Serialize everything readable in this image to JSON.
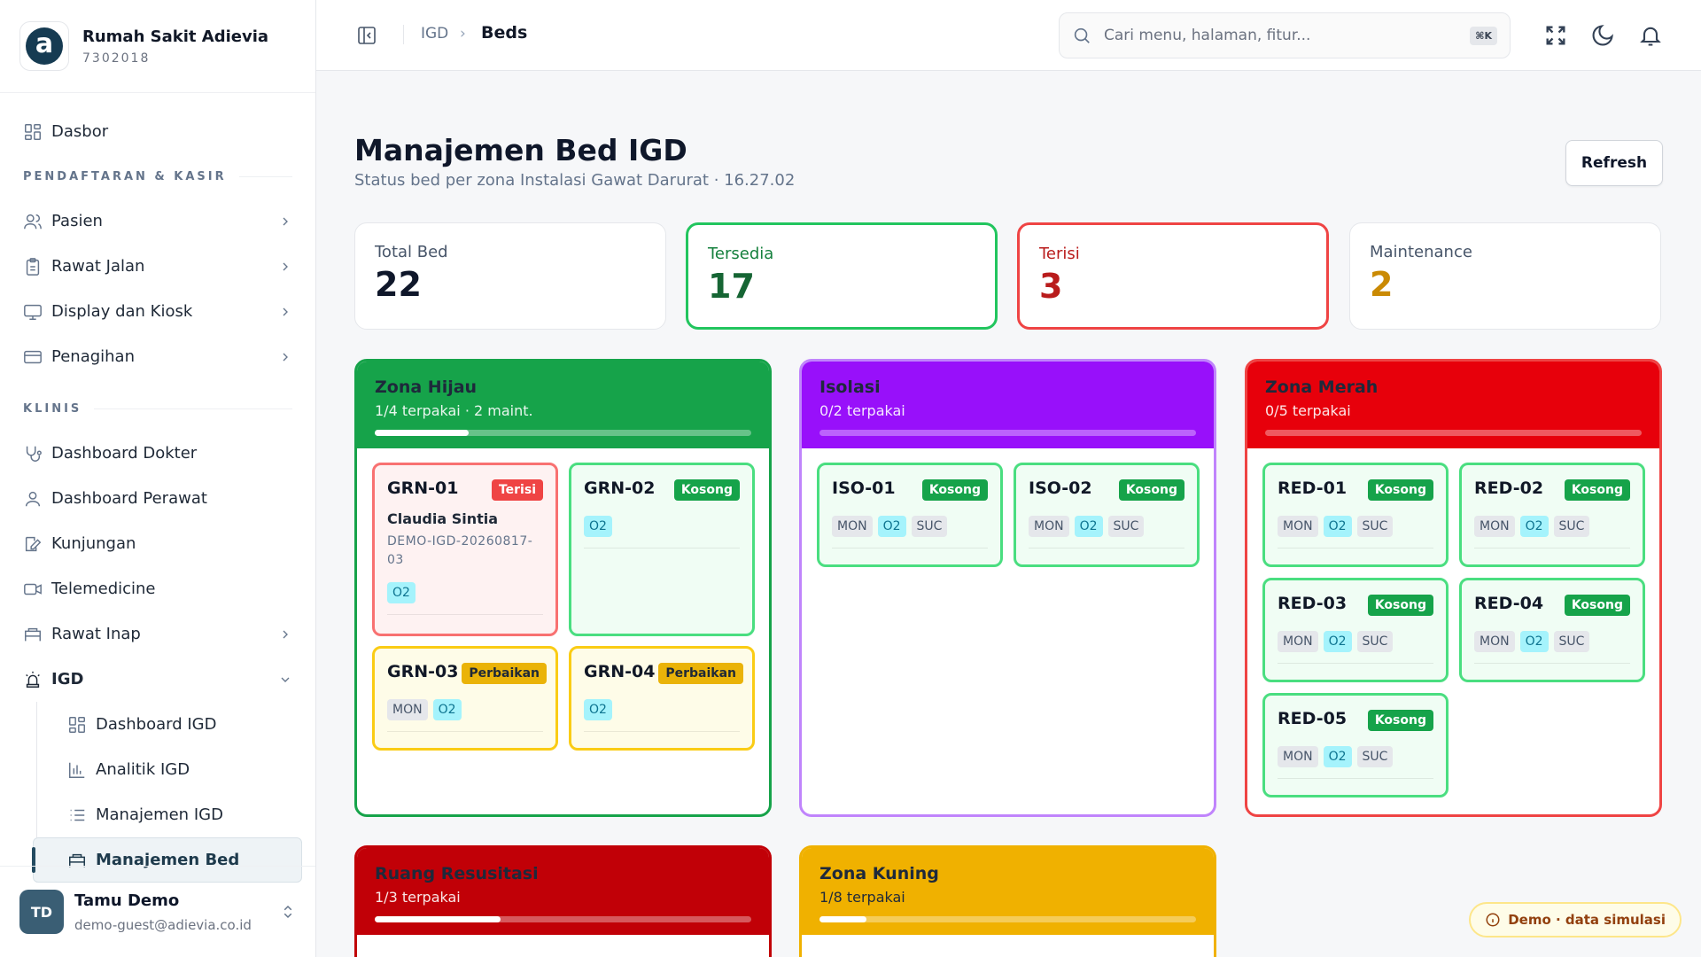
{
  "brand": {
    "name": "Rumah Sakit Adievia",
    "code": "7302018",
    "logo_letter": "a"
  },
  "sidebar": {
    "top_item": {
      "label": "Dasbor",
      "icon": "grid-icon"
    },
    "sections": [
      {
        "title": "PENDAFTARAN & KASIR",
        "items": [
          {
            "label": "Pasien",
            "icon": "users-icon"
          },
          {
            "label": "Rawat Jalan",
            "icon": "clipboard-icon"
          },
          {
            "label": "Display dan Kiosk",
            "icon": "monitor-icon"
          },
          {
            "label": "Penagihan",
            "icon": "credit-card-icon"
          }
        ]
      },
      {
        "title": "KLINIS",
        "items": [
          {
            "label": "Dashboard Dokter",
            "icon": "stethoscope-icon"
          },
          {
            "label": "Dashboard Perawat",
            "icon": "user-icon"
          },
          {
            "label": "Kunjungan",
            "icon": "edit-icon"
          },
          {
            "label": "Telemedicine",
            "icon": "video-icon"
          },
          {
            "label": "Rawat Inap",
            "icon": "bed-icon"
          },
          {
            "label": "IGD",
            "icon": "siren-icon"
          }
        ]
      }
    ],
    "igd_sub": [
      {
        "label": "Dashboard IGD",
        "icon": "grid-icon"
      },
      {
        "label": "Analitik IGD",
        "icon": "bar-chart-icon"
      },
      {
        "label": "Manajemen IGD",
        "icon": "list-icon"
      },
      {
        "label": "Manajemen Bed",
        "icon": "bed-icon"
      }
    ]
  },
  "user": {
    "initials": "TD",
    "name": "Tamu Demo",
    "email": "demo-guest@adievia.co.id"
  },
  "topbar": {
    "crumb_parent": "IGD",
    "crumb_sep": "›",
    "crumb_current": "Beds",
    "search_placeholder": "Cari menu, halaman, fitur...",
    "search_shortcut": "⌘K"
  },
  "page": {
    "title": "Manajemen Bed IGD",
    "subtitle": "Status bed per zona Instalasi Gawat Darurat  · 16.27.02",
    "refresh_label": "Refresh"
  },
  "stats": [
    {
      "label": "Total Bed",
      "value": "22"
    },
    {
      "label": "Tersedia",
      "value": "17"
    },
    {
      "label": "Terisi",
      "value": "3"
    },
    {
      "label": "Maintenance",
      "value": "2"
    }
  ],
  "colors": {
    "green": "#16a34a",
    "purple": "#9810fa",
    "red": "#e7000b",
    "darkred": "#c10007",
    "yellow": "#f0b100"
  },
  "zones": [
    {
      "name": "Zona Hijau",
      "sub": "1/4 terpakai · 2 maint.",
      "fill": 0.25,
      "beds": [
        {
          "id": "GRN-01",
          "status": "Terisi",
          "patient": "Claudia Sintia",
          "pid": "DEMO-IGD-20260817-03",
          "tags": [
            "O2"
          ]
        },
        {
          "id": "GRN-02",
          "status": "Kosong",
          "tags": [
            "O2"
          ]
        },
        {
          "id": "GRN-03",
          "status": "Perbaikan",
          "tags": [
            "MON",
            "O2"
          ]
        },
        {
          "id": "GRN-04",
          "status": "Perbaikan",
          "tags": [
            "O2"
          ]
        }
      ]
    },
    {
      "name": "Isolasi",
      "sub": "0/2 terpakai",
      "fill": 0,
      "beds": [
        {
          "id": "ISO-01",
          "status": "Kosong",
          "tags": [
            "MON",
            "O2",
            "SUC"
          ]
        },
        {
          "id": "ISO-02",
          "status": "Kosong",
          "tags": [
            "MON",
            "O2",
            "SUC"
          ]
        }
      ]
    },
    {
      "name": "Zona Merah",
      "sub": "0/5 terpakai",
      "fill": 0,
      "beds": [
        {
          "id": "RED-01",
          "status": "Kosong",
          "tags": [
            "MON",
            "O2",
            "SUC"
          ]
        },
        {
          "id": "RED-02",
          "status": "Kosong",
          "tags": [
            "MON",
            "O2",
            "SUC"
          ]
        },
        {
          "id": "RED-03",
          "status": "Kosong",
          "tags": [
            "MON",
            "O2",
            "SUC"
          ]
        },
        {
          "id": "RED-04",
          "status": "Kosong",
          "tags": [
            "MON",
            "O2",
            "SUC"
          ]
        },
        {
          "id": "RED-05",
          "status": "Kosong",
          "tags": [
            "MON",
            "O2",
            "SUC"
          ]
        }
      ]
    },
    {
      "name": "Ruang Resusitasi",
      "sub": "1/3 terpakai",
      "fill": 0.333
    },
    {
      "name": "Zona Kuning",
      "sub": "1/8 terpakai",
      "fill": 0.125
    }
  ],
  "demo_badge": "Demo · data simulasi"
}
